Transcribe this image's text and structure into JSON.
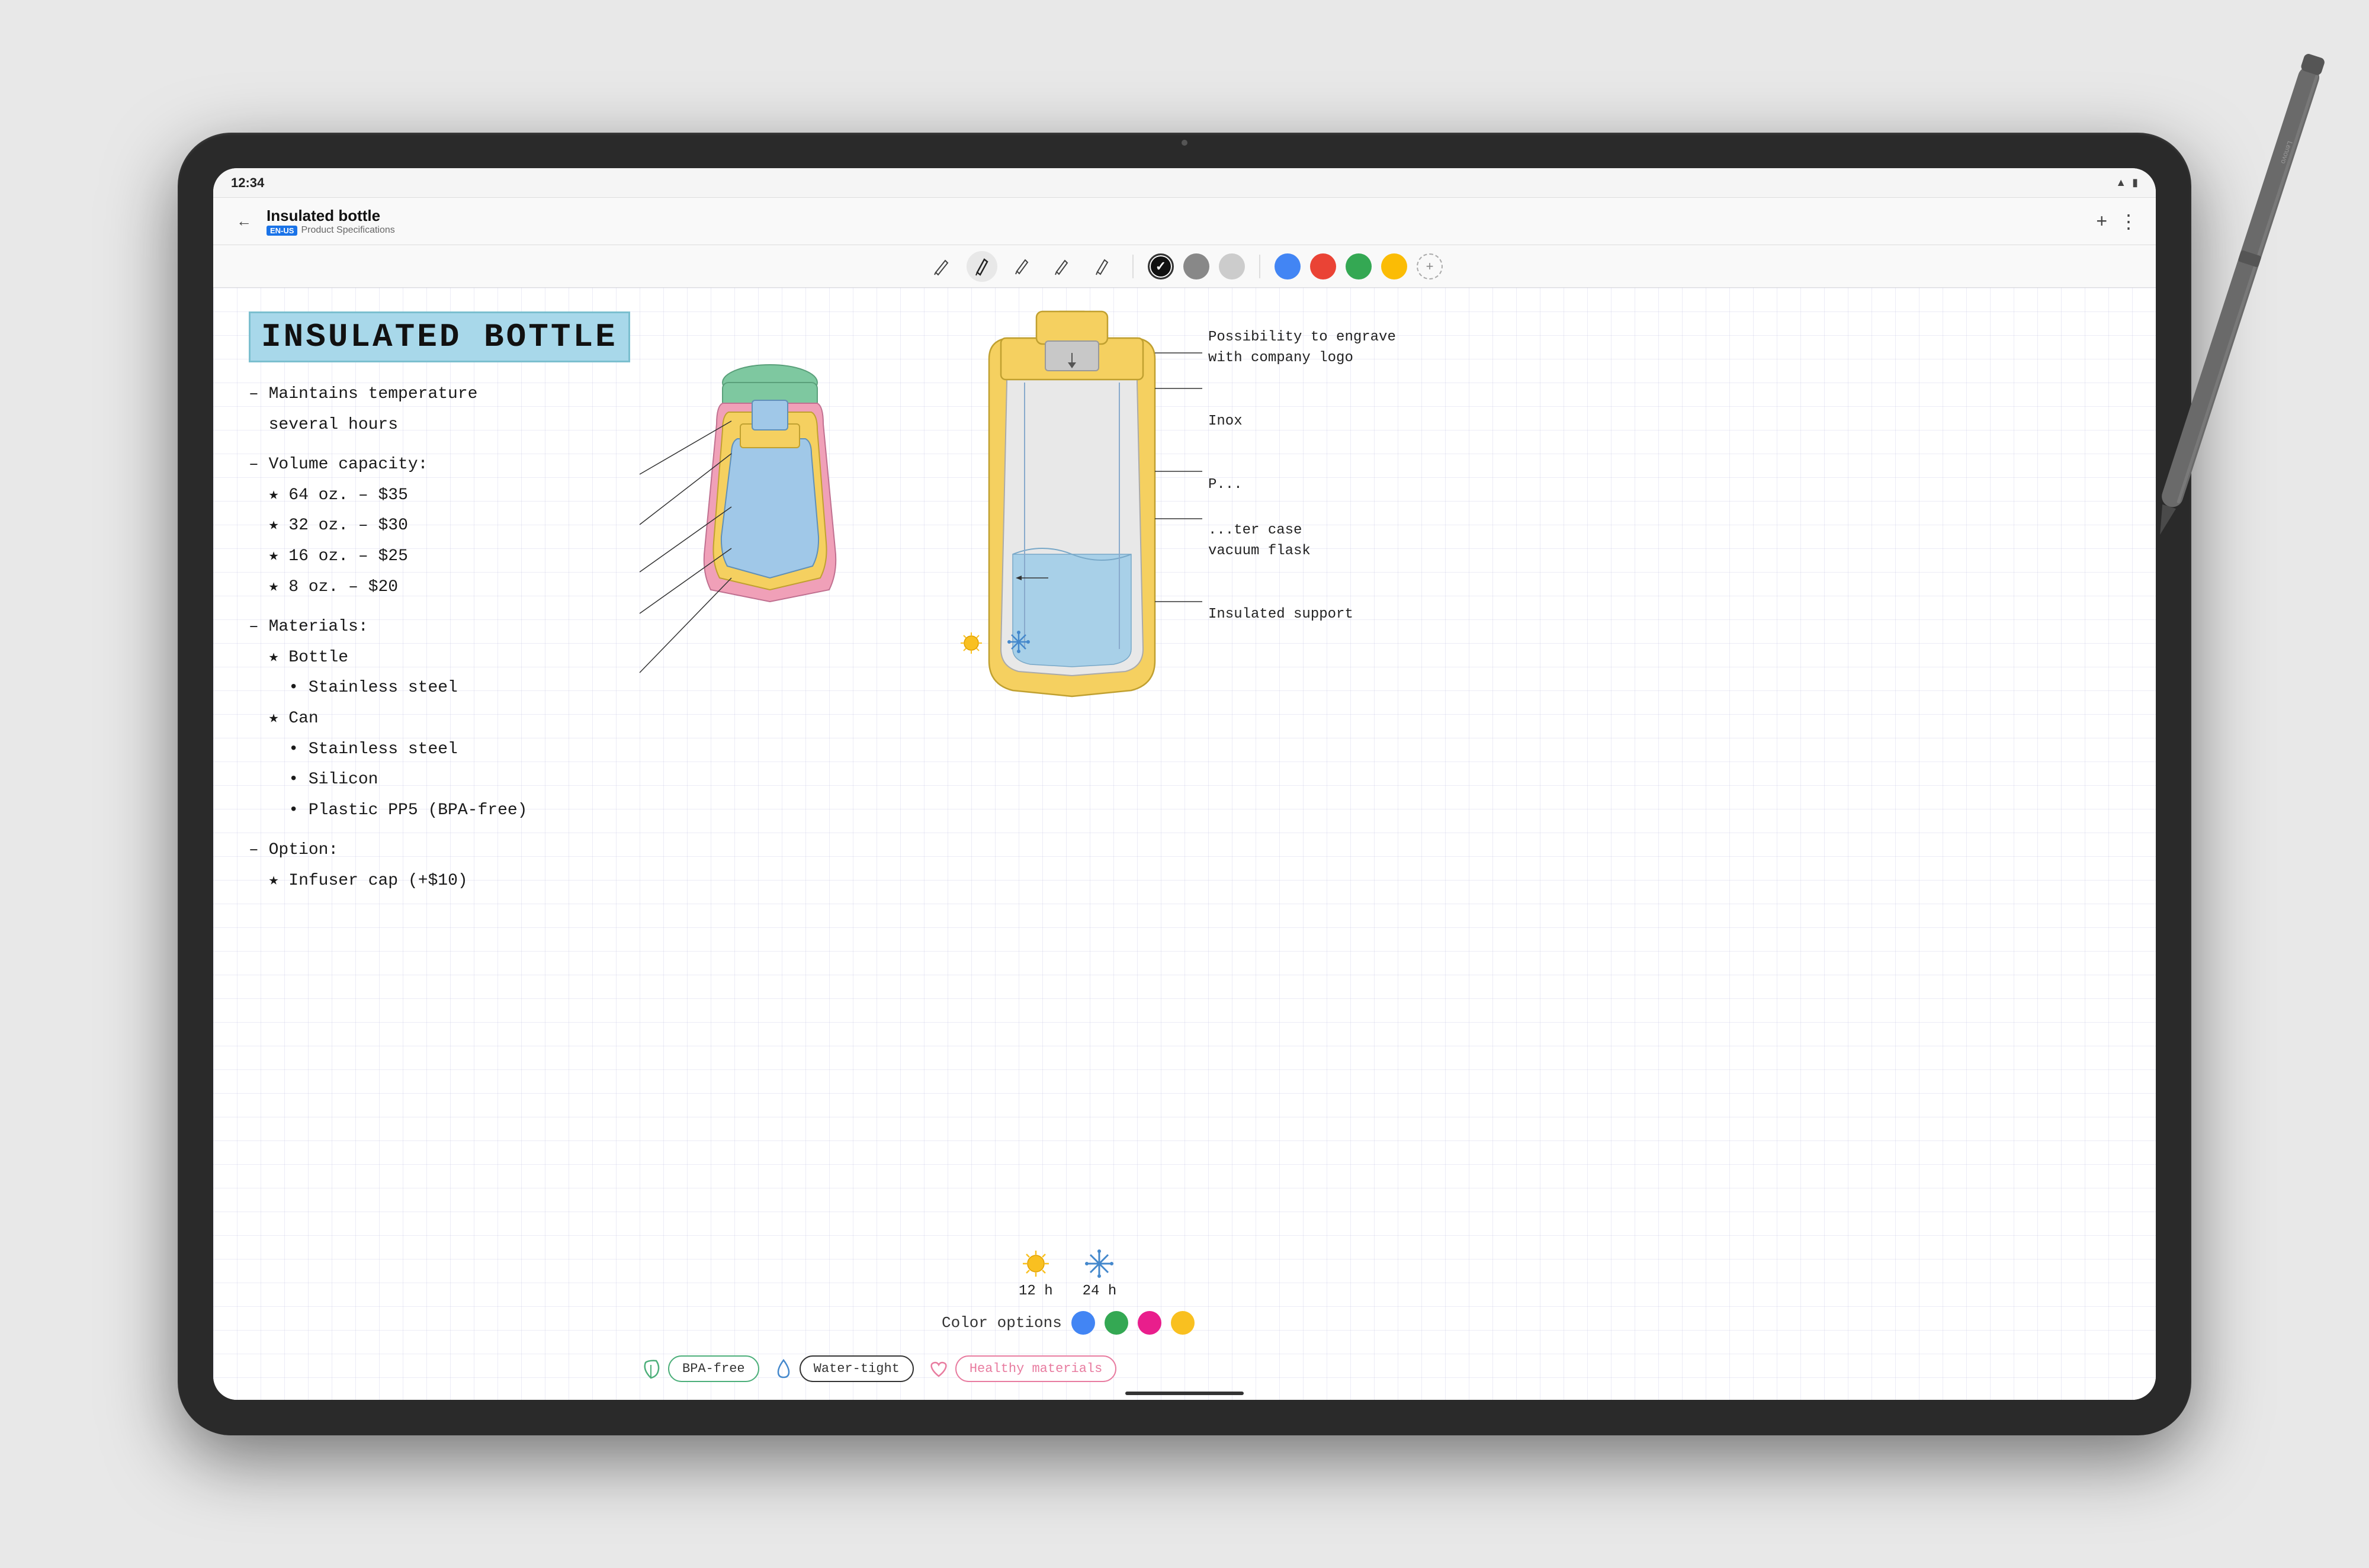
{
  "device": {
    "brand": "Lenovo",
    "time": "12:34"
  },
  "topbar": {
    "back_label": "←",
    "title": "Insulated bottle",
    "lang_badge": "EN-US",
    "subtitle": "Product Specifications",
    "plus_button": "+",
    "more_button": "⋮"
  },
  "toolbar": {
    "tools": [
      {
        "name": "pen1",
        "label": "pen-tool-1"
      },
      {
        "name": "pen2",
        "label": "pen-tool-2",
        "active": true
      },
      {
        "name": "pen3",
        "label": "pen-tool-3"
      },
      {
        "name": "pen4",
        "label": "pen-tool-4"
      },
      {
        "name": "pen5",
        "label": "pen-tool-5"
      }
    ],
    "colors": [
      {
        "name": "black",
        "hex": "#111111",
        "selected": true
      },
      {
        "name": "gray",
        "hex": "#888888"
      },
      {
        "name": "light-gray",
        "hex": "#cccccc"
      },
      {
        "name": "blue",
        "hex": "#4285f4"
      },
      {
        "name": "red",
        "hex": "#ea4335"
      },
      {
        "name": "green",
        "hex": "#34a853"
      },
      {
        "name": "yellow",
        "hex": "#fbbc05"
      }
    ]
  },
  "note": {
    "title": "INSULATED BOTTLE",
    "title_bg": "#a8d8ea",
    "sections": [
      {
        "id": "temp",
        "lines": [
          "– Maintains temperature",
          "  several hours"
        ]
      },
      {
        "id": "volume",
        "lines": [
          "– Volume capacity:",
          "  ★ 64 oz. – $35",
          "  ★ 32 oz. – $30",
          "  ★ 16 oz. – $25",
          "  ★ 8 oz. – $20"
        ]
      },
      {
        "id": "materials",
        "lines": [
          "– Materials:",
          "  ★ Bottle",
          "    • Stainless steel",
          "",
          "  ★ Can",
          "    • Stainless steel",
          "    • Silicon",
          "    • Plastic PP5 (BPA-free)"
        ]
      },
      {
        "id": "option",
        "lines": [
          "– Option:",
          "  ★ Infuser cap (+$10)"
        ]
      }
    ],
    "right_annotations": [
      {
        "text": "Possibility to engrave",
        "text2": "with company logo"
      },
      {
        "text": "Inox"
      },
      {
        "text": "P..."
      },
      {
        "text": "...ter case",
        "text2": "vacuum flask"
      },
      {
        "text": "Insulated support"
      }
    ],
    "time_icons": [
      {
        "icon": "☀",
        "label": "12 h"
      },
      {
        "icon": "❄",
        "label": "24 h"
      }
    ],
    "color_options_label": "Color options",
    "color_swatches": [
      {
        "name": "blue",
        "hex": "#4285f4"
      },
      {
        "name": "green",
        "hex": "#34a853"
      },
      {
        "name": "pink",
        "hex": "#e91e8c"
      },
      {
        "name": "yellow",
        "hex": "#f9c020"
      }
    ],
    "tags": [
      {
        "icon": "🌿",
        "label": "BPA-free",
        "style": "teal"
      },
      {
        "icon": "💧",
        "label": "Water-tight",
        "style": "outline"
      },
      {
        "icon": "♡",
        "label": "Healthy materials",
        "style": "pink"
      }
    ]
  }
}
